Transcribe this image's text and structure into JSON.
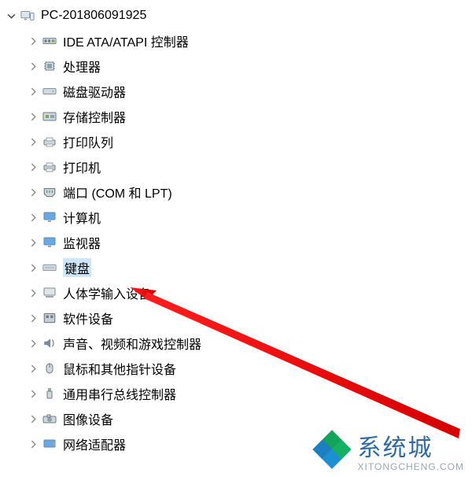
{
  "root": {
    "label": "PC-201806091925",
    "expanded": true
  },
  "items": [
    {
      "id": "ide-atapi",
      "label": "IDE ATA/ATAPI 控制器"
    },
    {
      "id": "processor",
      "label": "处理器"
    },
    {
      "id": "disk-drives",
      "label": "磁盘驱动器"
    },
    {
      "id": "storage",
      "label": "存储控制器"
    },
    {
      "id": "print-queues",
      "label": "打印队列"
    },
    {
      "id": "printers",
      "label": "打印机"
    },
    {
      "id": "ports",
      "label": "端口 (COM 和 LPT)"
    },
    {
      "id": "computer",
      "label": "计算机"
    },
    {
      "id": "monitors",
      "label": "监视器"
    },
    {
      "id": "keyboard",
      "label": "键盘",
      "selected": true
    },
    {
      "id": "hid",
      "label": "人体学输入设备"
    },
    {
      "id": "software",
      "label": "软件设备"
    },
    {
      "id": "sound",
      "label": "声音、视频和游戏控制器"
    },
    {
      "id": "mouse",
      "label": "鼠标和其他指针设备"
    },
    {
      "id": "usb",
      "label": "通用串行总线控制器"
    },
    {
      "id": "imaging",
      "label": "图像设备"
    },
    {
      "id": "network",
      "label": "网络适配器"
    }
  ],
  "watermark": {
    "main": "系统城",
    "sub": "XITONGCHENG.COM"
  }
}
